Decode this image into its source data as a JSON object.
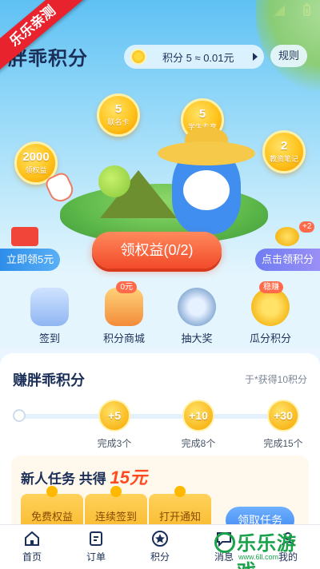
{
  "watermark": {
    "ribbon": "乐乐亲测",
    "brand": "乐乐游戏",
    "url": "www.6ll.com"
  },
  "header": {
    "title": "胖乖积分",
    "points_text": "积分 5 ≈ 0.01元",
    "rules_label": "规则"
  },
  "bubbles": [
    {
      "value": "5",
      "label": "联名卡"
    },
    {
      "value": "5",
      "label": "学生专享"
    },
    {
      "value": "2000",
      "label": "领权益"
    },
    {
      "value": "2",
      "label": "教资笔记"
    }
  ],
  "hero": {
    "claim_label": "领权益(0/2)",
    "left_label": "立即领5元",
    "right_label": "点击领积分",
    "coin_badge": "+2"
  },
  "quick_actions": [
    {
      "label": "签到",
      "badge": ""
    },
    {
      "label": "积分商城",
      "badge": "0元"
    },
    {
      "label": "抽大奖",
      "badge": ""
    },
    {
      "label": "瓜分积分",
      "badge": "稳赚"
    }
  ],
  "earn": {
    "title": "赚胖乖积分",
    "subtitle": "于*获得10积分",
    "milestones": [
      {
        "reward": "+5",
        "label": "完成3个"
      },
      {
        "reward": "+10",
        "label": "完成8个"
      },
      {
        "reward": "+30",
        "label": "完成15个"
      }
    ]
  },
  "newbie": {
    "title_prefix": "新人任务 共得",
    "amount": "15元",
    "gifts": [
      "免费权益",
      "连续签到",
      "打开通知"
    ],
    "get_task_label": "领取任务"
  },
  "tabbar": {
    "items": [
      "首页",
      "订单",
      "积分",
      "消息",
      "我的"
    ]
  },
  "colors": {
    "accent": "#f24a2a",
    "primary_blue": "#3c86f0",
    "gold": "#ffc31c"
  }
}
